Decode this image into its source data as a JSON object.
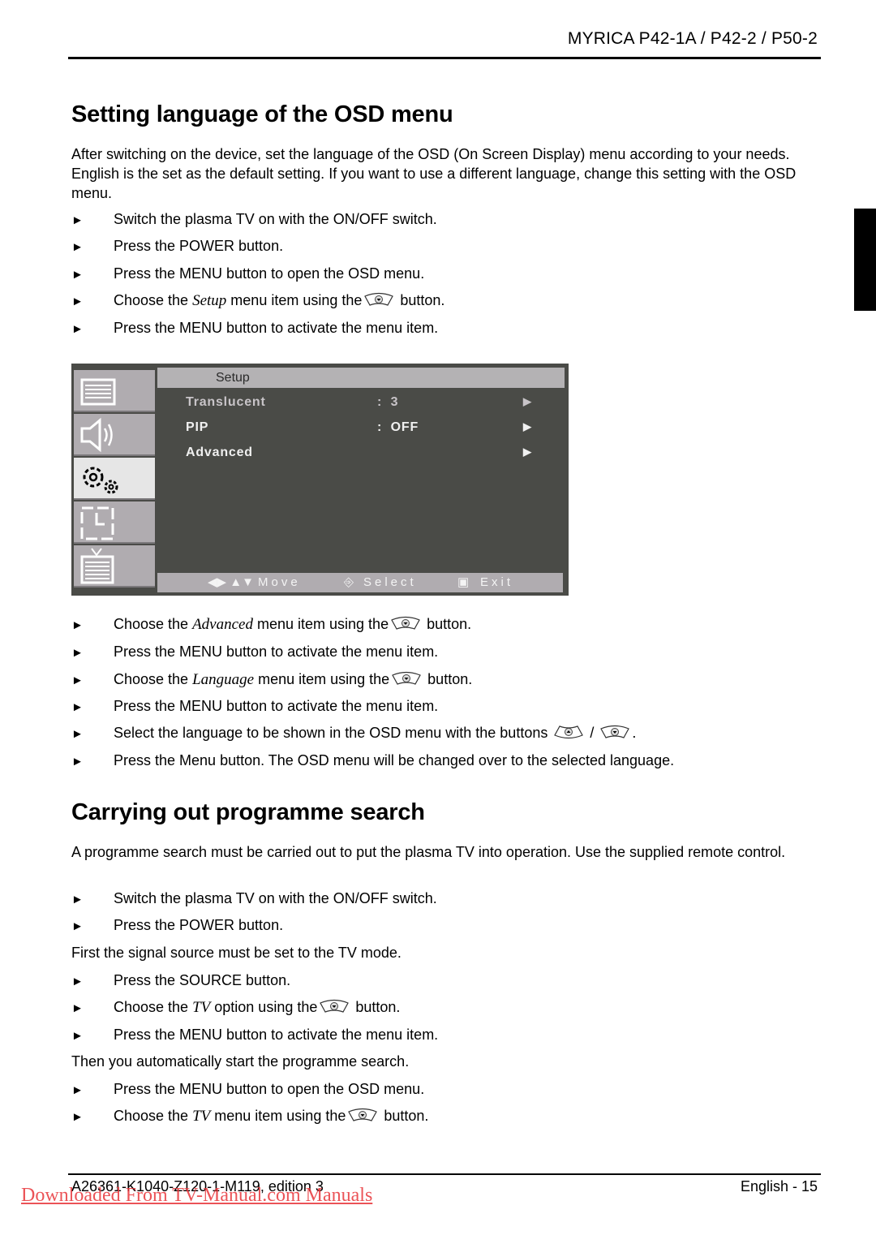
{
  "header": {
    "title": "MYRICA P42-1A / P42-2 / P50-2"
  },
  "section1": {
    "heading": "Setting language of the OSD menu",
    "intro": "After switching on the device, set the language of the OSD (On Screen Display) menu according to your needs. English is the set as the default setting. If you want to use a different language, change this setting with the OSD menu.",
    "steps_a": [
      {
        "pre": "Switch the plasma TV on with the ON/OFF switch.",
        "em": "",
        "post": ""
      },
      {
        "pre": "Press the POWER button.",
        "em": "",
        "post": ""
      },
      {
        "pre": "Press the MENU button to open the OSD menu.",
        "em": "",
        "post": ""
      },
      {
        "pre": "Choose the ",
        "em": "Setup",
        "post": " menu item using the",
        "after": " button."
      },
      {
        "pre": "Press the MENU button to activate the menu item.",
        "em": "",
        "post": ""
      }
    ],
    "steps_b": [
      {
        "pre": "Choose the ",
        "em": "Advanced",
        "post": " menu item using the",
        "after": " button."
      },
      {
        "pre": "Press the MENU button to activate the menu item.",
        "em": "",
        "post": ""
      },
      {
        "pre": "Choose the ",
        "em": "Language",
        "post": " menu item using the",
        "after": " button."
      },
      {
        "pre": "Press the MENU button to activate the menu item.",
        "em": "",
        "post": ""
      },
      {
        "pre": "Select the language to be shown in the OSD menu with the buttons",
        "em": "",
        "post": "",
        "sep": " / ",
        "after": "."
      },
      {
        "pre": "Press the Menu button. The OSD menu will be changed over to the selected language.",
        "em": "",
        "post": ""
      }
    ]
  },
  "osd": {
    "title": "Setup",
    "side_icons": [
      "picture-icon",
      "sound-icon",
      "setup-gears-icon",
      "clock-icon",
      "tv-icon"
    ],
    "active_index": 2,
    "rows": [
      {
        "label": "Translucent",
        "sep": ":",
        "value": "3",
        "arrow": "▶"
      },
      {
        "label": "PIP",
        "sep": ":",
        "value": "OFF",
        "arrow": "▶"
      },
      {
        "label": "Advanced",
        "sep": "",
        "value": "",
        "arrow": "▶"
      }
    ],
    "footer": {
      "move": "Move",
      "select": "Select",
      "exit": "Exit"
    }
  },
  "section2": {
    "heading": "Carrying out programme search",
    "intro": "A programme search must be carried out to put the plasma TV into operation. Use the supplied remote control.",
    "step1": "Switch the plasma TV on with the ON/OFF switch.",
    "step2": "Press the POWER button.",
    "note1": "First the signal source must be set to the TV mode.",
    "step3": "Press the SOURCE button.",
    "step4": {
      "pre": "Choose the ",
      "em": "TV",
      "post": " option using the",
      "after": " button."
    },
    "step5": "Press the MENU button to activate the menu item.",
    "note2": "Then you automatically start the programme search.",
    "step6": "Press the MENU button to open the OSD menu.",
    "step7": {
      "pre": "Choose the ",
      "em": "TV",
      "post": " menu item using the",
      "after": " button."
    }
  },
  "footer": {
    "doc_id": "A26361-K1040-Z120-1-M119, edition 3",
    "page": "English - 15",
    "watermark": "Downloaded From TV-Manual.com Manuals"
  },
  "bullet": "►"
}
